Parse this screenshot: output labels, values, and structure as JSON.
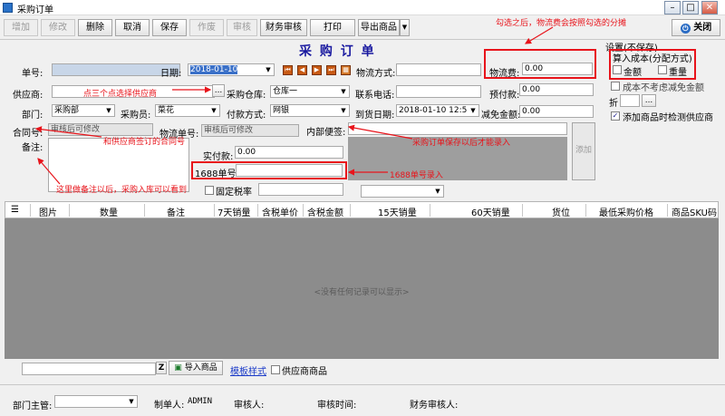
{
  "window": {
    "title": "采购订单",
    "close_label": "关闭",
    "min_glyph": "–",
    "max_glyph": "□",
    "close_glyph": "✕"
  },
  "toolbar": {
    "add": "增加",
    "edit": "修改",
    "delete": "删除",
    "cancel": "取消",
    "save": "保存",
    "void": "作废",
    "audit": "审核",
    "finance_audit": "财务审核",
    "print": "打印",
    "export": "导出商品"
  },
  "form": {
    "heading": "采 购 订 单",
    "order_no_label": "单号:",
    "order_no_value": "",
    "date_label": "日期:",
    "date_value": "2018-01-10",
    "logistics_method_label": "物流方式:",
    "logistics_method_value": "",
    "supplier_label": "供应商:",
    "supplier_value": "",
    "ellipsis": "...",
    "warehouse_label": "采购仓库:",
    "warehouse_value": "仓库一",
    "phone_label": "联系电话:",
    "phone_value": "",
    "prepay_label": "预付款:",
    "prepay_value": "0.00",
    "dept_label": "部门:",
    "dept_value": "采购部",
    "buyer_label": "采购员:",
    "buyer_value": "菜花",
    "payment_label": "付款方式:",
    "payment_value": "网银",
    "arrival_label": "到货日期:",
    "arrival_value": "2018-01-10 12:5",
    "discount_label": "减免金额:",
    "discount_value": "0.00",
    "contract_label": "合同号:",
    "contract_value": "审核后可修改",
    "tracking_label": "物流单号:",
    "tracking_value": "审核后可修改",
    "memo_label": "内部便签:",
    "memo_value": "",
    "remark_label": "备注:",
    "remark_value": "",
    "actual_pay_label": "实付款:",
    "actual_pay_value": "0.00",
    "no1688_label": "1688单号:",
    "no1688_value": "",
    "fixed_tax_label": "固定税率",
    "fixed_tax_value": "",
    "add_button": "添加",
    "freight_label": "物流费:",
    "freight_value": "0.00"
  },
  "settings": {
    "title": "设置(不保存)",
    "cost_title": "算入成本(分配方式)",
    "by_amount": "金额",
    "by_weight": "重量",
    "exclude_discount": "成本不考虑减免金额",
    "discount_label": "折",
    "check_supplier": "添加商品时检测供应商",
    "check_supplier_checked": true
  },
  "annotations": {
    "freight_note": "勾选之后，物流费会按照勾选的分摊",
    "supplier_note": "点三个点选择供应商",
    "contract_note": "和供应商签订的合同号",
    "memo_note": "采购订单保存以后才能录入",
    "no1688_note": "1688单号录入",
    "remark_note": "这里做备注以后，采购入库可以看到"
  },
  "grid": {
    "columns": [
      "图片",
      "数量",
      "备注",
      "7天销量",
      "含税单价",
      "含税金额",
      "15天销量",
      "60天销量",
      "货位",
      "最低采购价格",
      "商品SKU码"
    ],
    "empty_text": "<没有任何记录可以显示>"
  },
  "bottom": {
    "search_value": "",
    "z_label": "Z",
    "import_label": "导入商品",
    "template_link": "模板样式",
    "supplier_goods": "供应商商品"
  },
  "footer": {
    "dept_head_label": "部门主管:",
    "dept_head_value": "",
    "creator_label": "制单人:",
    "creator_value": "ADMIN",
    "auditor_label": "审核人:",
    "audit_time_label": "审核时间:",
    "finance_auditor_label": "财务审核人:"
  },
  "colors": {
    "annotation_red": "#e8141b",
    "heading_blue": "#1a1aa0",
    "grid_gray": "#8c8c8c"
  }
}
